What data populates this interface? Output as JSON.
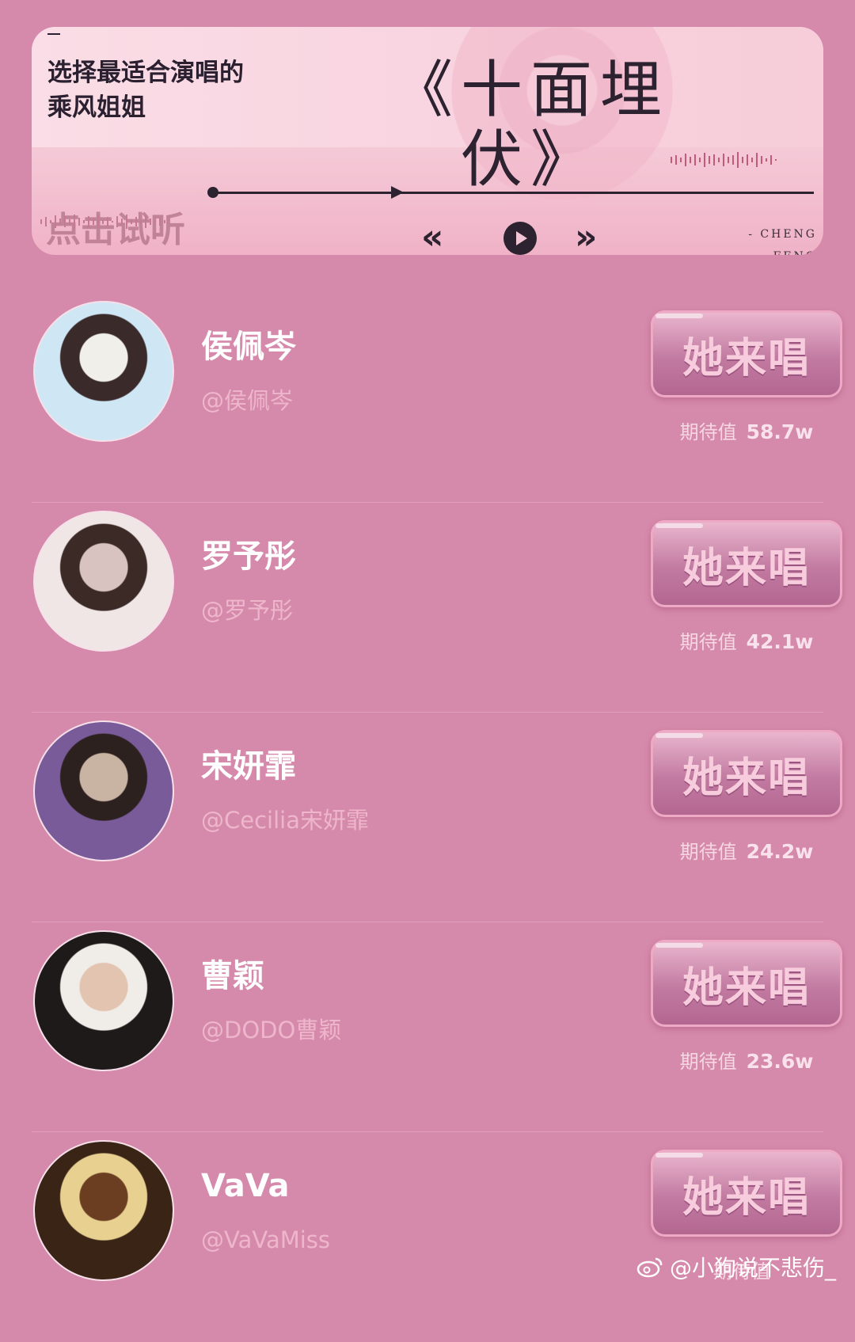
{
  "player": {
    "dash": "–",
    "subtitle_line1": "选择最适合演唱的",
    "subtitle_line2": "乘风姐姐",
    "song_title": "《十面埋伏》",
    "listen_label": "点击试听",
    "prev_icon": "«",
    "next_icon": "»",
    "credit_line1": "- CHENG",
    "credit_line2": "FENG",
    "progress_fraction": 0.31
  },
  "singers": [
    {
      "name": "侯佩岑",
      "handle": "@侯佩岑",
      "button": "她来唱",
      "expect_label": "期待值",
      "expect_value": "58.7w",
      "avatar_colors": [
        "#cfe6f5",
        "#f1efe9",
        "#3a2a2a"
      ]
    },
    {
      "name": "罗予彤",
      "handle": "@罗予彤",
      "button": "她来唱",
      "expect_label": "期待值",
      "expect_value": "42.1w",
      "avatar_colors": [
        "#f1e6e6",
        "#d9c3c0",
        "#3b2a25"
      ]
    },
    {
      "name": "宋妍霏",
      "handle": "@Cecilia宋妍霏",
      "button": "她来唱",
      "expect_label": "期待值",
      "expect_value": "24.2w",
      "avatar_colors": [
        "#7a5b9a",
        "#c9b3a3",
        "#2d2120"
      ]
    },
    {
      "name": "曹颖",
      "handle": "@DODO曹颖",
      "button": "她来唱",
      "expect_label": "期待值",
      "expect_value": "23.6w",
      "avatar_colors": [
        "#1e1a1a",
        "#e2c4b0",
        "#f0ece8"
      ]
    },
    {
      "name": "VaVa",
      "handle": "@VaVaMiss",
      "button": "她来唱",
      "expect_label": "期待值",
      "expect_value": "",
      "avatar_colors": [
        "#3a2416",
        "#6b3e22",
        "#e8d090"
      ]
    }
  ],
  "watermark": {
    "text": "@小狗说不悲伤_",
    "icon": "weibo-icon"
  }
}
